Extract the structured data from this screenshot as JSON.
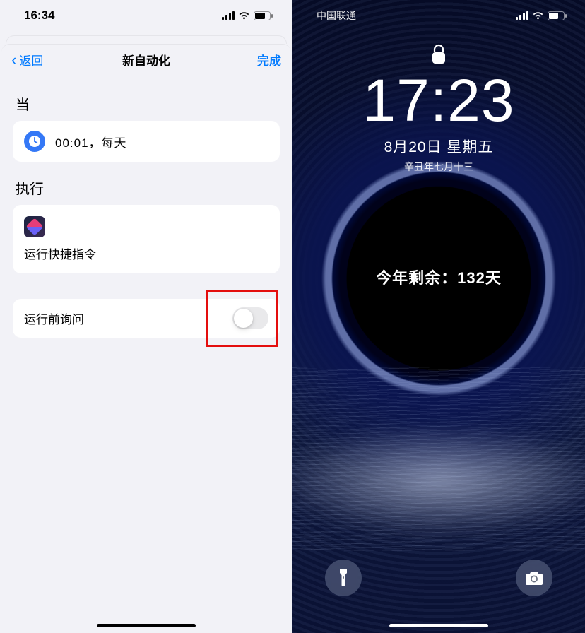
{
  "left": {
    "status_time": "16:34",
    "nav": {
      "back": "返回",
      "title": "新自动化",
      "done": "完成"
    },
    "when_label": "当",
    "when_value": "00:01，每天",
    "do_label": "执行",
    "do_value": "运行快捷指令",
    "toggle_label": "运行前询问",
    "toggle_on": false
  },
  "right": {
    "carrier": "中国联通",
    "time": "17:23",
    "date": "8月20日 星期五",
    "lunar": "辛丑年七月十三",
    "remaining": "今年剩余：132天"
  }
}
